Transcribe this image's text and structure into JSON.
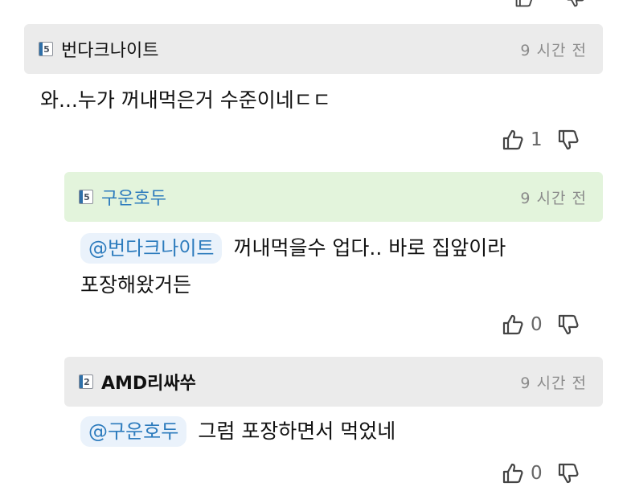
{
  "comments": [
    {
      "level": "5",
      "nickname": "번다크나이트",
      "time": "9 시간 전",
      "text": "와...누가 꺼내먹은거 수준이네ㄷㄷ",
      "likes": "1"
    },
    {
      "level": "5",
      "nickname": "구운호두",
      "time": "9 시간 전",
      "mention": "@번다크나이트",
      "text_line1": "꺼내먹을수 업다.. 바로 집앞이라",
      "text_line2": "포장해왔거든",
      "likes": "0"
    },
    {
      "level": "2",
      "nickname": "AMD리싸쑤",
      "time": "9 시간 전",
      "mention": "@구운호두",
      "text": "그럼 포장하면서 먹었네",
      "likes": "0"
    }
  ],
  "colors": {
    "header_gray": "#ebebeb",
    "header_green": "#e3f4dc",
    "nick_blue": "#2c7bbd",
    "mention_bg": "#eaf2fb"
  },
  "icons": [
    "thumbs-up-icon",
    "thumbs-down-icon",
    "level-badge-icon"
  ]
}
